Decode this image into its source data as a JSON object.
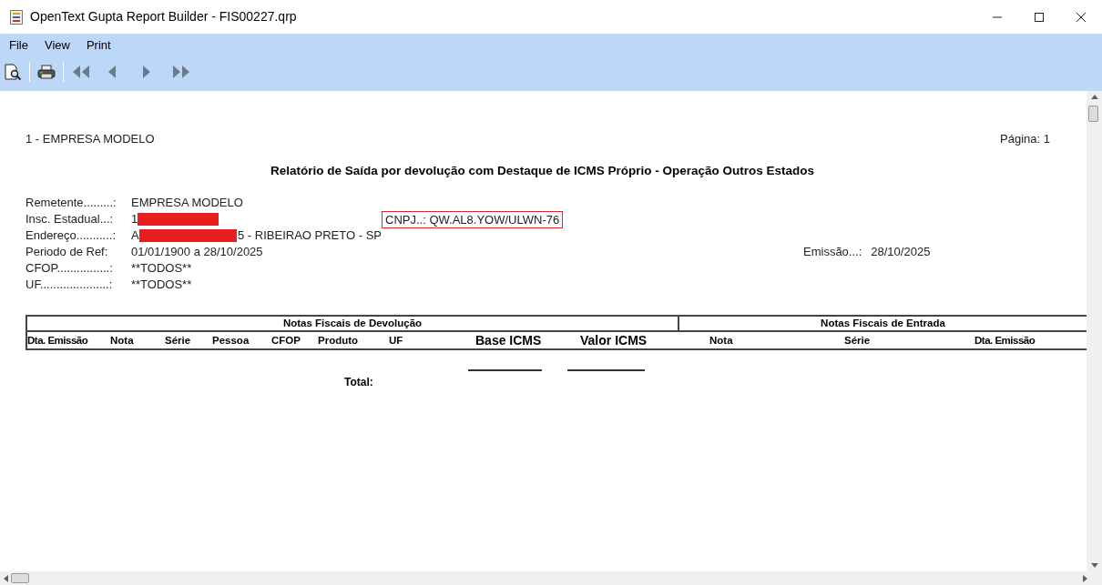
{
  "window": {
    "title": "OpenText Gupta Report Builder - FIS00227.qrp"
  },
  "menu": [
    "File",
    "View",
    "Print"
  ],
  "report": {
    "company": "1 - EMPRESA MODELO",
    "page": "Página: 1",
    "title": "Relatório de Saída por devolução com Destaque de ICMS Próprio - Operação Outros Estados",
    "fields": [
      {
        "label": "Remetente.........:",
        "value": "EMPRESA MODELO",
        "redacted": false
      },
      {
        "label": "Insc. Estadual...:",
        "value": "1",
        "redacted": true
      },
      {
        "label": "Endereço...........:",
        "value": "A",
        "redacted": true,
        "suffix": "5 - RIBEIRAO PRETO - SP"
      },
      {
        "label": "Periodo de Ref:",
        "value": "01/01/1900 a 28/10/2025",
        "redacted": false
      },
      {
        "label": "CFOP................:",
        "value": "**TODOS**",
        "redacted": false
      },
      {
        "label": "UF.....................:",
        "value": "**TODOS**",
        "redacted": false
      }
    ],
    "cnpj": {
      "text": "CNPJ..: QW.AL8.YOW/ULWN-76",
      "highlighted": true
    },
    "emissao": {
      "label": "Emissão...:",
      "value": "28/10/2025"
    },
    "table": {
      "groups": [
        "Notas Fiscais de Devolução",
        "Notas Fiscais de Entrada"
      ],
      "columns": [
        "Dta. Emissão",
        "Nota",
        "Série",
        "Pessoa",
        "CFOP",
        "Produto",
        "UF",
        "Base ICMS",
        "Valor ICMS",
        "Nota",
        "Série",
        "Dta. Emissão"
      ],
      "total_label": "Total:"
    }
  }
}
